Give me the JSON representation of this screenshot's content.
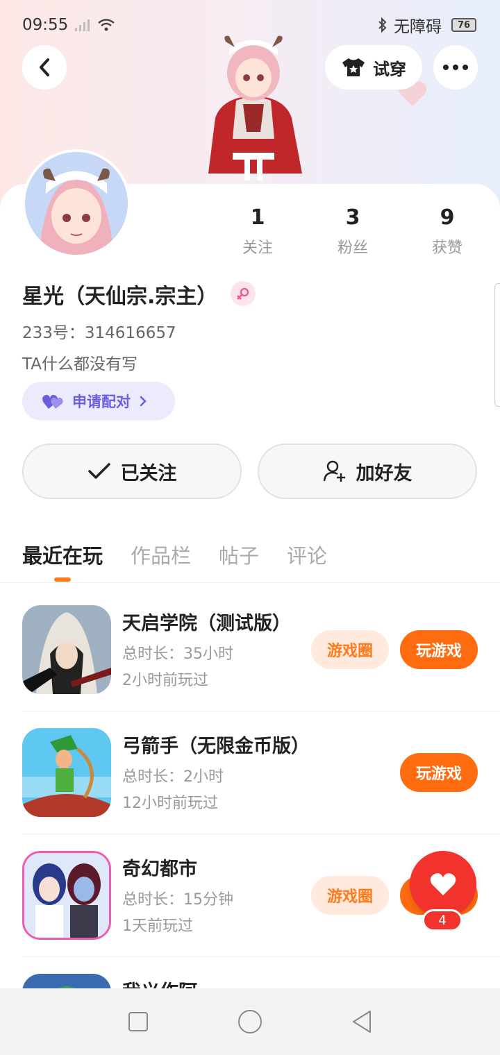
{
  "status_bar": {
    "time": "09:55",
    "accessibility": "无障碍",
    "battery": "76"
  },
  "header": {
    "back_icon": "chevron-left-icon",
    "tryon_label": "试穿",
    "more_icon": "more-dots-icon"
  },
  "profile": {
    "name": "星光（天仙宗.宗主）",
    "id_label": "233号：314616657",
    "bio": "TA什么都没有写",
    "pair_label": "申请配对",
    "stats": [
      {
        "value": "1",
        "label": "关注"
      },
      {
        "value": "3",
        "label": "粉丝"
      },
      {
        "value": "9",
        "label": "获赞"
      }
    ]
  },
  "actions": {
    "follow_label": "已关注",
    "add_friend_label": "加好友"
  },
  "tabs": [
    {
      "label": "最近在玩",
      "active": true
    },
    {
      "label": "作品栏",
      "active": false
    },
    {
      "label": "帖子",
      "active": false
    },
    {
      "label": "评论",
      "active": false
    }
  ],
  "games": [
    {
      "title": "天启学院（测试版）",
      "duration": "总时长：35小时",
      "last_played": "2小时前玩过",
      "circle_label": "游戏圈",
      "play_label": "玩游戏"
    },
    {
      "title": "弓箭手（无限金币版）",
      "duration": "总时长：2小时",
      "last_played": "12小时前玩过",
      "play_label": "玩游戏"
    },
    {
      "title": "奇幻都市",
      "duration": "总时长：15分钟",
      "last_played": "1天前玩过",
      "circle_label": "游戏圈",
      "play_label": "玩游戏"
    },
    {
      "title": "我义作阿"
    }
  ],
  "floating_like": {
    "count": "4"
  },
  "colors": {
    "accent": "#ff6b0f",
    "like_red": "#f2322c",
    "pair_purple": "#6b5ce0"
  }
}
